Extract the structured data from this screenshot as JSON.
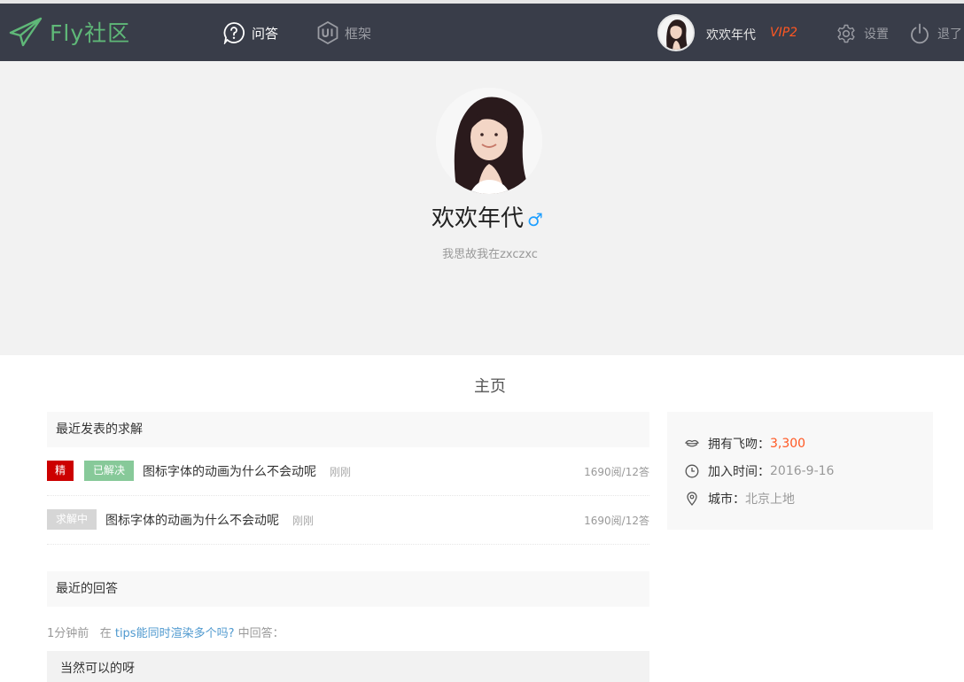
{
  "header": {
    "logo_text": "Fly社区",
    "nav": [
      {
        "label": "问答",
        "icon": "question-icon"
      },
      {
        "label": "框架",
        "icon": "ui-icon"
      }
    ],
    "user": {
      "name": "欢欢年代",
      "vip": "VIP2"
    },
    "settings_label": "设置",
    "logout_label": "退了"
  },
  "profile": {
    "name": "欢欢年代",
    "gender_symbol": "♂",
    "signature": "我思故我在zxczxc"
  },
  "page_title": "主页",
  "questions_section": {
    "title": "最近发表的求解",
    "items": [
      {
        "badges": [
          "精",
          "已解决"
        ],
        "title": "图标字体的动画为什么不会动呢",
        "time": "刚刚",
        "stats": "1690阅/12答"
      },
      {
        "badges": [
          "求解中"
        ],
        "title": "图标字体的动画为什么不会动呢",
        "time": "刚刚",
        "stats": "1690阅/12答"
      }
    ]
  },
  "answers_section": {
    "title": "最近的回答",
    "items": [
      {
        "time": "1分钟前",
        "prefix": "在",
        "question": "tips能同时渲染多个吗?",
        "suffix": "中回答：",
        "content": "当然可以的呀"
      }
    ]
  },
  "sidebar": {
    "kiss_label": "拥有飞吻：",
    "kiss_value": "3,300",
    "join_label": "加入时间：",
    "join_value": "2016-9-16",
    "city_label": "城市：",
    "city_value": "北京上地"
  },
  "colors": {
    "header_bg": "#393d49",
    "logo_green": "#5fb878",
    "vip_orange": "#ff5722",
    "badge_red": "#cc0000",
    "link_blue": "#4f99cf"
  }
}
